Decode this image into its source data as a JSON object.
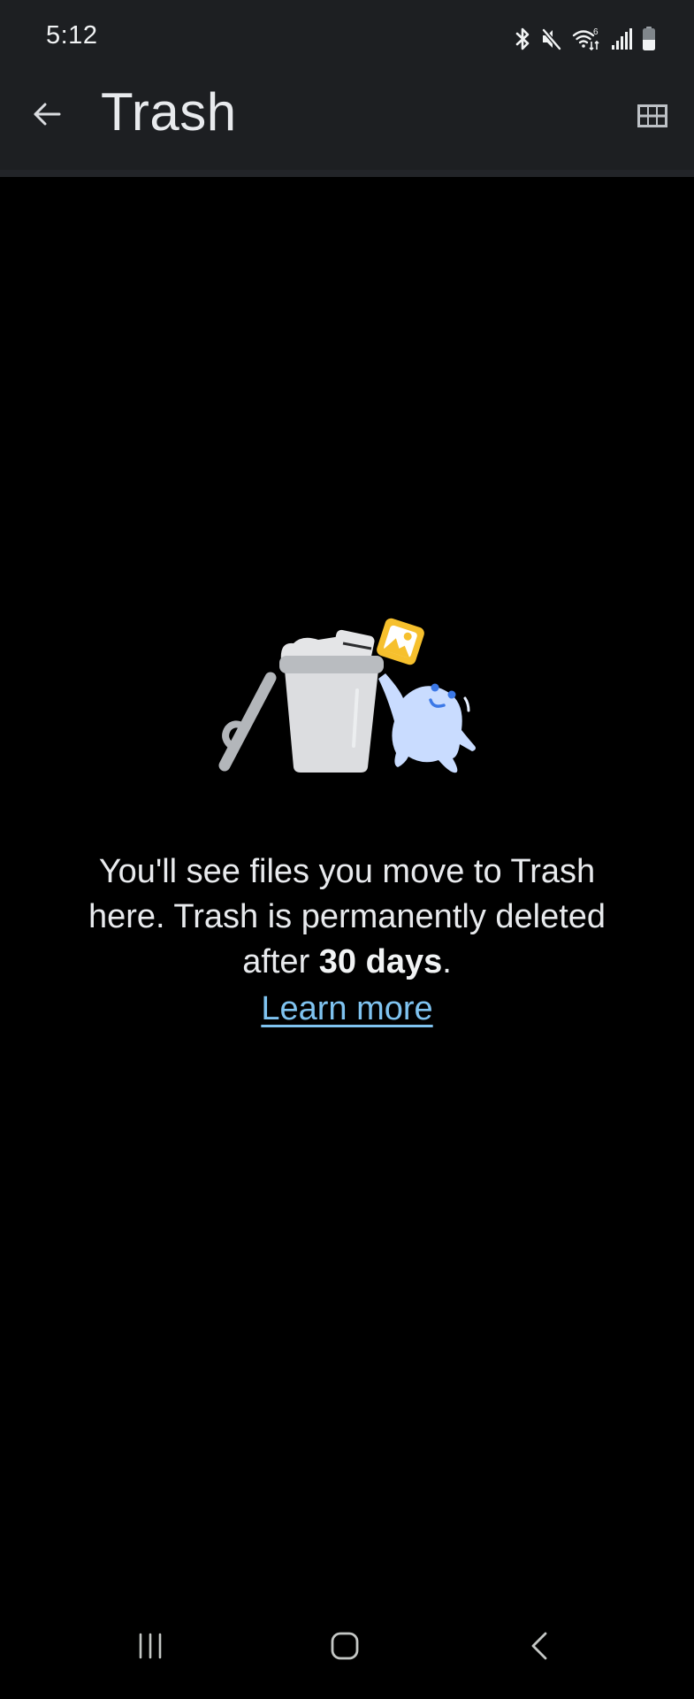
{
  "status_bar": {
    "time": "5:12",
    "icons": [
      "bluetooth-icon",
      "mute-icon",
      "wifi-6-icon",
      "signal-icon",
      "battery-icon"
    ]
  },
  "app_bar": {
    "title": "Trash",
    "back_icon": "arrow-back-icon",
    "view_toggle_icon": "grid-view-icon"
  },
  "empty_state": {
    "illustration": "trash-can-with-ghost-illustration",
    "message_part1": "You'll see files you move to Trash here. Trash is permanently deleted after ",
    "message_bold": "30 days",
    "message_end": ".",
    "link_label": "Learn more",
    "link_color": "#7fc3f0"
  },
  "nav_bar": {
    "recents_icon": "recents-icon",
    "home_icon": "home-icon",
    "back_icon": "back-icon"
  },
  "colors": {
    "app_bar_bg": "#1d1f22",
    "page_bg": "#000000",
    "text": "#e8eaed"
  }
}
